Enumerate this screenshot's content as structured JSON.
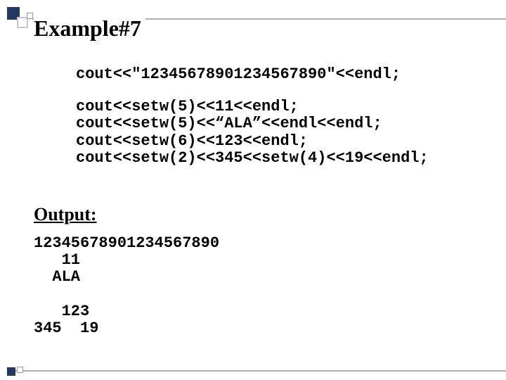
{
  "title": "Example#7",
  "code": {
    "line1": "cout<<\"12345678901234567890\"<<endl;",
    "line2": "cout<<setw(5)<<11<<endl;",
    "line3": "cout<<setw(5)<<“ALA”<<endl<<endl;",
    "line4": "cout<<setw(6)<<123<<endl;",
    "line5": "cout<<setw(2)<<345<<setw(4)<<19<<endl;"
  },
  "output_label": "Output:",
  "output": {
    "line1": "12345678901234567890",
    "line2": "   11",
    "line3": "  ALA",
    "line4": "",
    "line5": "   123",
    "line6": "345  19"
  }
}
